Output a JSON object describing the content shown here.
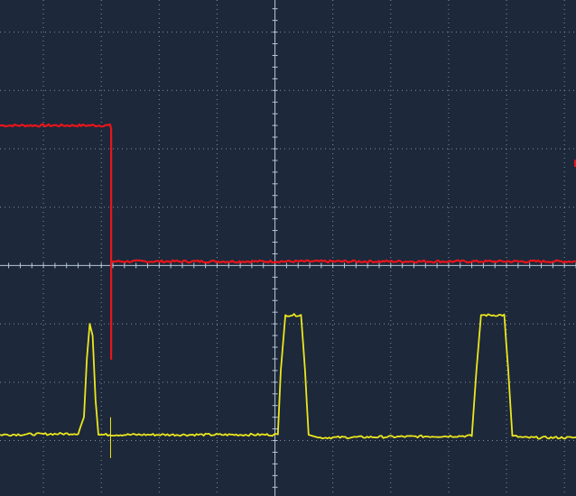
{
  "screen": {
    "background": "#1d283a",
    "grid_color": "#8fa3bd",
    "axis_color": "#b8c7da"
  },
  "chart_data": {
    "type": "line",
    "title": "",
    "xlabel": "",
    "ylabel": "",
    "grid": true,
    "x_divisions": 10,
    "y_divisions": 8.5,
    "xlim": [
      -4.75,
      5.2
    ],
    "ylim": [
      -3.95,
      4.55
    ],
    "series": [
      {
        "color": "#e8151b",
        "stroke_width": 2.2,
        "noise": 0.02,
        "x": [
          -4.75,
          -2.85,
          -2.83,
          -2.83,
          -2.83,
          -2.8,
          5.2
        ],
        "y": [
          2.4,
          2.4,
          2.35,
          -1.6,
          0.05,
          0.07,
          0.07
        ]
      },
      {
        "color": "#ece71e",
        "stroke_width": 1.8,
        "noise": 0.02,
        "x": [
          -4.75,
          -3.4,
          -3.3,
          -3.25,
          -3.2,
          -3.15,
          -3.1,
          -3.05,
          -2.95,
          0.05,
          0.1,
          0.18,
          0.45,
          0.52,
          0.58,
          0.75,
          3.4,
          3.48,
          3.56,
          3.96,
          4.03,
          4.1,
          4.3,
          5.2
        ],
        "y": [
          -2.9,
          -2.88,
          -2.6,
          -1.6,
          -1.0,
          -1.2,
          -2.3,
          -2.9,
          -2.9,
          -2.9,
          -1.8,
          -0.85,
          -0.85,
          -1.8,
          -2.9,
          -2.95,
          -2.92,
          -1.8,
          -0.85,
          -0.85,
          -1.8,
          -2.92,
          -2.95,
          -2.95
        ]
      }
    ],
    "markers": [
      {
        "color": "#e8151b",
        "x": 5.2,
        "y": 1.75
      }
    ]
  }
}
